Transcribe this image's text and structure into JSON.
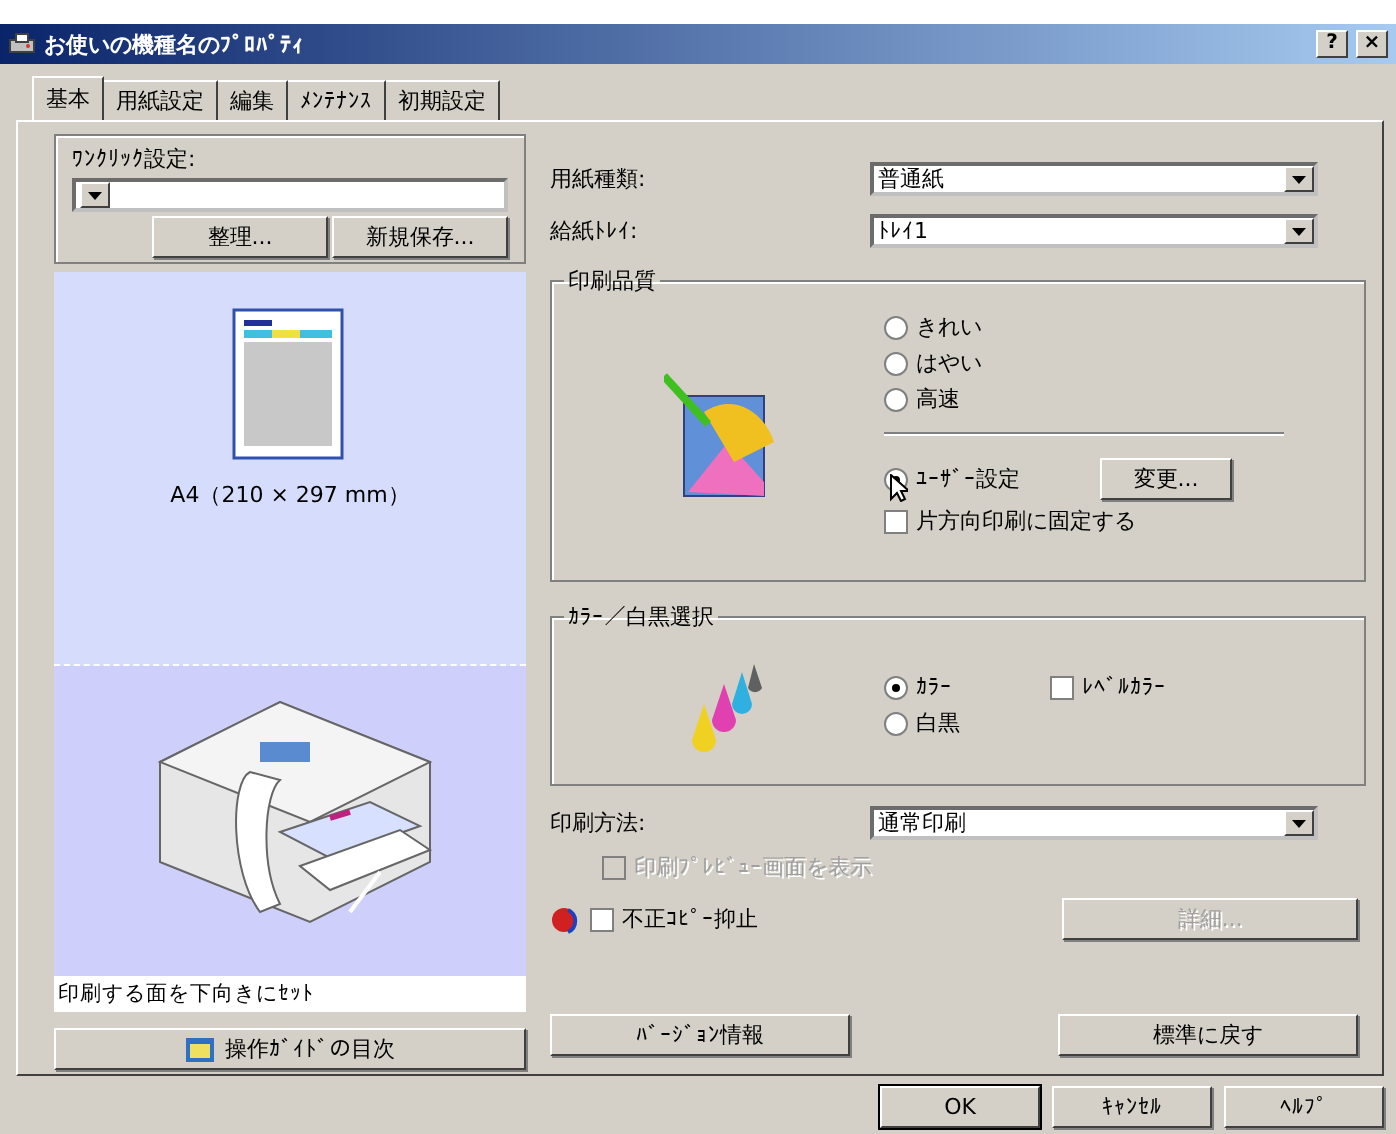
{
  "window": {
    "title": "お使いの機種名のﾌﾟﾛﾊﾟﾃｨ",
    "help_button": "?",
    "close_button": "×"
  },
  "tabs": [
    {
      "label": "基本",
      "selected": true
    },
    {
      "label": "用紙設定",
      "selected": false
    },
    {
      "label": "編集",
      "selected": false
    },
    {
      "label": "ﾒﾝﾃﾅﾝｽ",
      "selected": false
    },
    {
      "label": "初期設定",
      "selected": false
    }
  ],
  "one_click": {
    "label": "ﾜﾝｸﾘｯｸ設定:",
    "buttons": [
      "整理...",
      "新規保存..."
    ]
  },
  "paper_preview": {
    "size_label": "A4（210 × 297 mm）"
  },
  "guide": {
    "caption": "印刷する面を下向きにｾｯﾄ",
    "button": "操作ｶﾞｲﾄﾞの目次"
  },
  "paper_type": {
    "label": "用紙種類:",
    "value": "普通紙"
  },
  "paper_tray": {
    "label": "給紙ﾄﾚｲ:",
    "value": "ﾄﾚｲ1"
  },
  "quality": {
    "title": "印刷品質",
    "options": [
      {
        "label": "きれい",
        "selected": false
      },
      {
        "label": "はやい",
        "selected": false
      },
      {
        "label": "高速",
        "selected": false
      },
      {
        "label": "ﾕｰｻﾞｰ設定",
        "selected": true
      }
    ],
    "change_button": "変更...",
    "one_way": {
      "label": "片方向印刷に固定する",
      "checked": false
    }
  },
  "color": {
    "title": "ｶﾗｰ／白黒選択",
    "options": [
      {
        "label": "ｶﾗｰ",
        "selected": true
      },
      {
        "label": "白黒",
        "selected": false
      }
    ],
    "level_color": {
      "label": "ﾚﾍﾞﾙｶﾗｰ",
      "checked": false
    }
  },
  "print_method": {
    "label": "印刷方法:",
    "value": "通常印刷"
  },
  "preview": {
    "label": "印刷ﾌﾟﾚﾋﾞｭｰ画面を表示",
    "checked": false,
    "disabled": true
  },
  "copy_guard": {
    "label": "不正ｺﾋﾟｰ抑止",
    "checked": false
  },
  "detail_button": {
    "label": "詳細...",
    "disabled": true
  },
  "version_button": "ﾊﾞｰｼﾞｮﾝ情報",
  "default_button": "標準に戻す",
  "dialog_buttons": [
    {
      "label": "OK",
      "default": true
    },
    {
      "label": "ｷｬﾝｾﾙ",
      "default": false
    },
    {
      "label": "ﾍﾙﾌﾟ",
      "default": false
    }
  ]
}
